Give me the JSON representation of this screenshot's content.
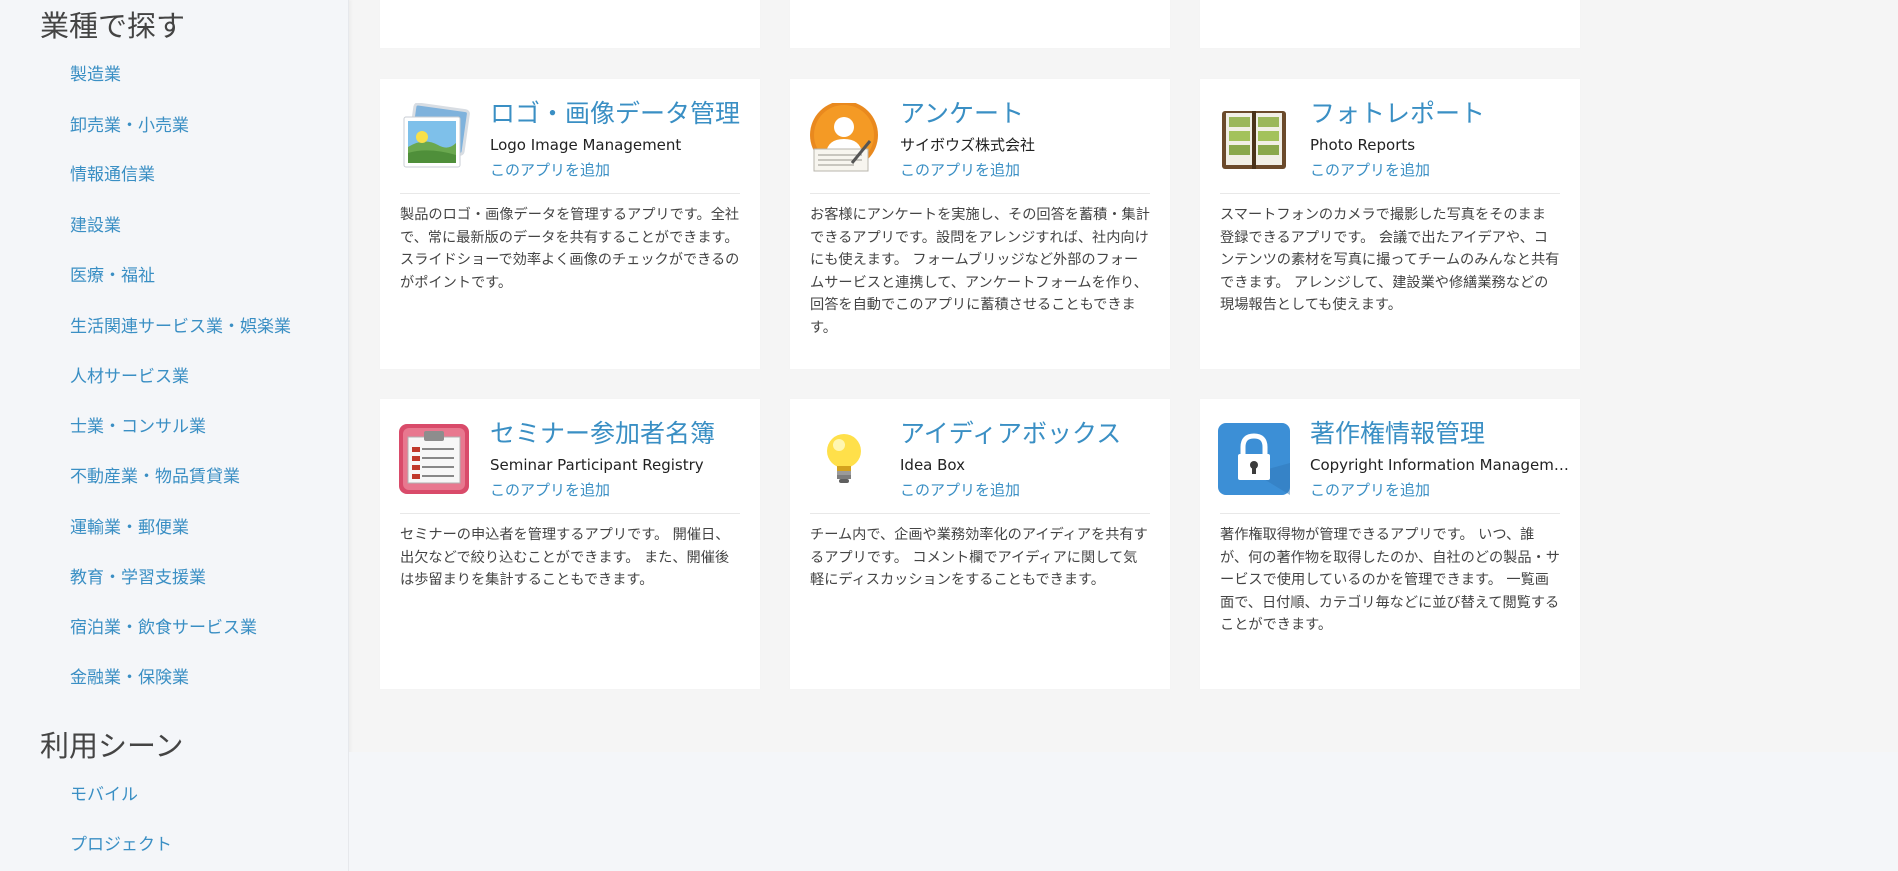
{
  "sidebar": {
    "industry_title": "業種で探す",
    "industries": [
      "製造業",
      "卸売業・小売業",
      "情報通信業",
      "建設業",
      "医療・福祉",
      "生活関連サービス業・娯楽業",
      "人材サービス業",
      "士業・コンサル業",
      "不動産業・物品賃貸業",
      "運輸業・郵便業",
      "教育・学習支援業",
      "宿泊業・飲食サービス業",
      "金融業・保険業"
    ],
    "scene_title": "利用シーン",
    "scenes": [
      "モバイル",
      "プロジェクト"
    ]
  },
  "cards": [
    {
      "title": "ロゴ・画像データ管理",
      "subtitle": "Logo Image Management",
      "add_label": "このアプリを追加",
      "icon": "image-gallery-icon",
      "description": "製品のロゴ・画像データを管理するアプリです。全社で、常に最新版のデータを共有することができます。 スライドショーで効率よく画像のチェックができるのがポイントです。"
    },
    {
      "title": "アンケート",
      "subtitle": "サイボウズ株式会社",
      "add_label": "このアプリを追加",
      "icon": "survey-person-icon",
      "description": "お客様にアンケートを実施し、その回答を蓄積・集計できるアプリです。設問をアレンジすれば、社内向けにも使えます。 フォームブリッジなど外部のフォームサービスと連携して、アンケートフォームを作り、回答を自動でこのアプリに蓄積させることもできます。"
    },
    {
      "title": "フォトレポート",
      "subtitle": "Photo Reports",
      "add_label": "このアプリを追加",
      "icon": "photo-album-icon",
      "description": "スマートフォンのカメラで撮影した写真をそのまま登録できるアプリです。 会議で出たアイデアや、コンテンツの素材を写真に撮ってチームのみんなと共有できます。 アレンジして、建設業や修繕業務などの現場報告としても使えます。"
    },
    {
      "title": "セミナー参加者名簿",
      "subtitle": "Seminar Participant Registry",
      "add_label": "このアプリを追加",
      "icon": "registry-card-icon",
      "description": "セミナーの申込者を管理するアプリです。 開催日、出欠などで絞り込むことができます。 また、開催後は歩留まりを集計することもできます。"
    },
    {
      "title": "アイディアボックス",
      "subtitle": "Idea Box",
      "add_label": "このアプリを追加",
      "icon": "lightbulb-icon",
      "description": "チーム内で、企画や業務効率化のアイディアを共有するアプリです。 コメント欄でアイディアに関して気軽にディスカッションをすることもできます。"
    },
    {
      "title": "著作権情報管理",
      "subtitle": "Copyright Information Management",
      "add_label": "このアプリを追加",
      "icon": "padlock-icon",
      "description": "著作権取得物が管理できるアプリです。 いつ、誰が、何の著作物を取得したのか、自社のどの製品・サービスで使用しているのかを管理できます。 一覧画面で、日付順、カテゴリ毎などに並び替えて閲覧することができます。"
    }
  ]
}
